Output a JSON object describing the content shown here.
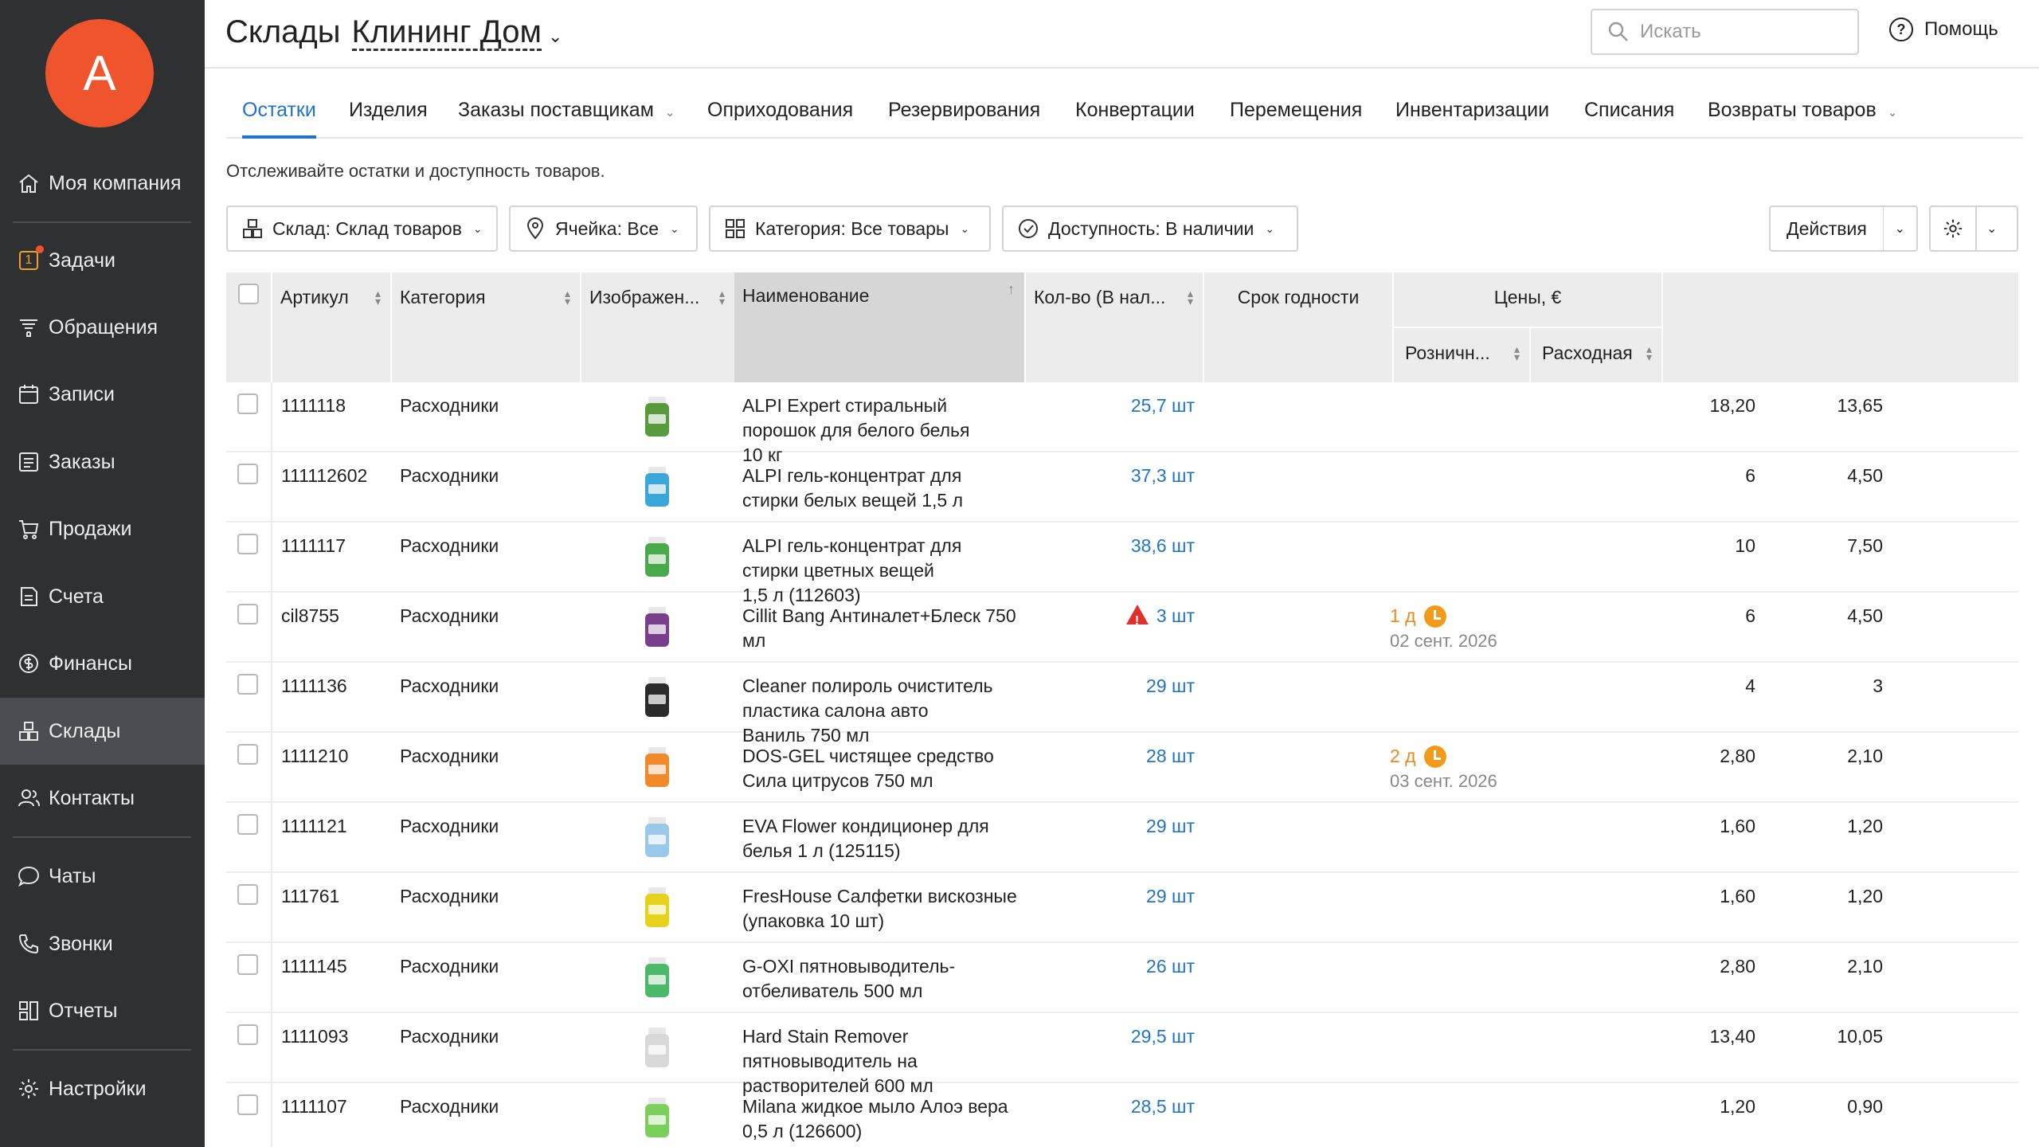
{
  "sidebar": {
    "avatar_letter": "A",
    "items": [
      {
        "label": "Моя компания",
        "icon": "home-icon"
      },
      {
        "label": "Задачи",
        "icon": "tasks-icon",
        "badge_text": "1"
      },
      {
        "label": "Обращения",
        "icon": "funnel-icon"
      },
      {
        "label": "Записи",
        "icon": "calendar-icon"
      },
      {
        "label": "Заказы",
        "icon": "orders-icon"
      },
      {
        "label": "Продажи",
        "icon": "cart-icon"
      },
      {
        "label": "Счета",
        "icon": "invoice-icon"
      },
      {
        "label": "Финансы",
        "icon": "dollar-icon"
      },
      {
        "label": "Склады",
        "icon": "warehouse-icon",
        "active": true
      },
      {
        "label": "Контакты",
        "icon": "contacts-icon"
      },
      {
        "label": "Чаты",
        "icon": "chat-icon"
      },
      {
        "label": "Звонки",
        "icon": "phone-icon"
      },
      {
        "label": "Отчеты",
        "icon": "reports-icon"
      },
      {
        "label": "Настройки",
        "icon": "gear-icon"
      }
    ]
  },
  "header": {
    "title_prefix": "Склады",
    "warehouse_name": "Клининг Дом",
    "search_placeholder": "Искать",
    "help_label": "Помощь"
  },
  "tabs": [
    {
      "label": "Остатки",
      "active": true
    },
    {
      "label": "Изделия"
    },
    {
      "label": "Заказы поставщикам",
      "dropdown": true
    },
    {
      "label": "Оприходования"
    },
    {
      "label": "Резервирования"
    },
    {
      "label": "Конвертации"
    },
    {
      "label": "Перемещения"
    },
    {
      "label": "Инвентаризации"
    },
    {
      "label": "Списания"
    },
    {
      "label": "Возвраты товаров",
      "dropdown": true
    }
  ],
  "subtitle": "Отслеживайте остатки и доступность товаров.",
  "filters": {
    "warehouse": "Склад: Склад товаров",
    "cell": "Ячейка: Все",
    "category": "Категория: Все товары",
    "availability": "Доступность: В наличии",
    "actions": "Действия"
  },
  "table": {
    "columns": {
      "sku": "Артикул",
      "category": "Категория",
      "image": "Изображен...",
      "name": "Наименование",
      "qty": "Кол-во (В нал...",
      "expiry": "Срок годности",
      "prices": "Цены, €",
      "retail": "Розничн...",
      "cost": "Расходная"
    },
    "rows": [
      {
        "sku": "1111118",
        "category": "Расходники",
        "name_l1": "ALPI Expert стиральный порошок для белого белья",
        "name_l2": "10 кг",
        "qty": "25,7 шт",
        "warn": false,
        "exp": "",
        "exp_date": "",
        "retail": "18,20",
        "cost": "13,65",
        "img": "#5a9a3e"
      },
      {
        "sku": "111112602",
        "category": "Расходники",
        "name_l1": "ALPI гель-концентрат для стирки белых вещей 1,5 л",
        "name_l2": "",
        "qty": "37,3 шт",
        "warn": false,
        "exp": "",
        "exp_date": "",
        "retail": "6",
        "cost": "4,50",
        "img": "#3aa7d8"
      },
      {
        "sku": "1111117",
        "category": "Расходники",
        "name_l1": "ALPI гель-концентрат для стирки цветных вещей",
        "name_l2": "1,5 л (112603)",
        "qty": "38,6 шт",
        "warn": false,
        "exp": "",
        "exp_date": "",
        "retail": "10",
        "cost": "7,50",
        "img": "#48a84a"
      },
      {
        "sku": "cil8755",
        "category": "Расходники",
        "name_l1": "Cillit Bang Антиналет+Блеск 750 мл",
        "name_l2": "",
        "qty": "3 шт",
        "warn": true,
        "exp": "1 д",
        "exp_date": "02 сент. 2026",
        "retail": "6",
        "cost": "4,50",
        "img": "#7a3f8a"
      },
      {
        "sku": "1111136",
        "category": "Расходники",
        "name_l1": "Cleaner полироль очиститель пластика салона авто",
        "name_l2": "Ваниль 750 мл",
        "qty": "29 шт",
        "warn": false,
        "exp": "",
        "exp_date": "",
        "retail": "4",
        "cost": "3",
        "img": "#2b2b2b"
      },
      {
        "sku": "1111210",
        "category": "Расходники",
        "name_l1": "DOS-GEL чистящее средство Сила цитрусов 750 мл",
        "name_l2": "",
        "qty": "28 шт",
        "warn": false,
        "exp": "2 д",
        "exp_date": "03 сент. 2026",
        "retail": "2,80",
        "cost": "2,10",
        "img": "#f08a2a"
      },
      {
        "sku": "1111121",
        "category": "Расходники",
        "name_l1": "EVA Flower кондиционер для белья 1 л (125115)",
        "name_l2": "",
        "qty": "29 шт",
        "warn": false,
        "exp": "",
        "exp_date": "",
        "retail": "1,60",
        "cost": "1,20",
        "img": "#9ac8e8"
      },
      {
        "sku": "111761",
        "category": "Расходники",
        "name_l1": "FresHouse Салфетки вискозные (упаковка 10 шт)",
        "name_l2": "",
        "qty": "29 шт",
        "warn": false,
        "exp": "",
        "exp_date": "",
        "retail": "1,60",
        "cost": "1,20",
        "img": "#e6d21a"
      },
      {
        "sku": "1111145",
        "category": "Расходники",
        "name_l1": "G-OXI пятновыводитель-отбеливатель 500 мл",
        "name_l2": "",
        "qty": "26 шт",
        "warn": false,
        "exp": "",
        "exp_date": "",
        "retail": "2,80",
        "cost": "2,10",
        "img": "#4cb86a"
      },
      {
        "sku": "1111093",
        "category": "Расходники",
        "name_l1": "Hard Stain Remover пятновыводитель на",
        "name_l2": "растворителей 600 мл",
        "qty": "29,5 шт",
        "warn": false,
        "exp": "",
        "exp_date": "",
        "retail": "13,40",
        "cost": "10,05",
        "img": "#d8d8d8"
      },
      {
        "sku": "1111107",
        "category": "Расходники",
        "name_l1": "Milana жидкое мыло Алоэ вера 0,5 л (126600)",
        "name_l2": "",
        "qty": "28,5 шт",
        "warn": false,
        "exp": "",
        "exp_date": "",
        "retail": "1,20",
        "cost": "0,90",
        "img": "#7ccf5a"
      }
    ]
  }
}
